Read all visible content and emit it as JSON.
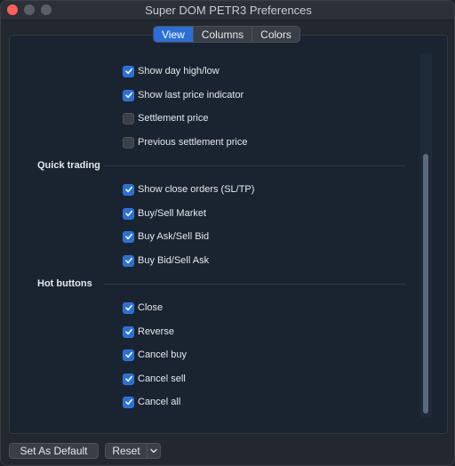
{
  "window": {
    "title": "Super DOM PETR3 Preferences"
  },
  "tabs": [
    {
      "label": "View",
      "active": true
    },
    {
      "label": "Columns",
      "active": false
    },
    {
      "label": "Colors",
      "active": false
    }
  ],
  "view": {
    "items_top": [
      {
        "label": "Show day high/low",
        "checked": true
      },
      {
        "label": "Show last price indicator",
        "checked": true
      },
      {
        "label": "Settlement price",
        "checked": false
      },
      {
        "label": "Previous settlement price",
        "checked": false
      }
    ],
    "quick_trading": {
      "title": "Quick trading",
      "items": [
        {
          "label": "Show close orders (SL/TP)",
          "checked": true
        },
        {
          "label": "Buy/Sell Market",
          "checked": true
        },
        {
          "label": "Buy Ask/Sell Bid",
          "checked": true
        },
        {
          "label": "Buy Bid/Sell Ask",
          "checked": true
        }
      ]
    },
    "hot_buttons": {
      "title": "Hot buttons",
      "items": [
        {
          "label": "Close",
          "checked": true
        },
        {
          "label": "Reverse",
          "checked": true
        },
        {
          "label": "Cancel buy",
          "checked": true
        },
        {
          "label": "Cancel sell",
          "checked": true
        },
        {
          "label": "Cancel all",
          "checked": true
        }
      ]
    }
  },
  "footer": {
    "set_default_label": "Set As Default",
    "reset_label": "Reset"
  },
  "colors": {
    "accent": "#2a6fd6",
    "panel_bg": "#1a2431",
    "window_bg": "#23272e"
  }
}
